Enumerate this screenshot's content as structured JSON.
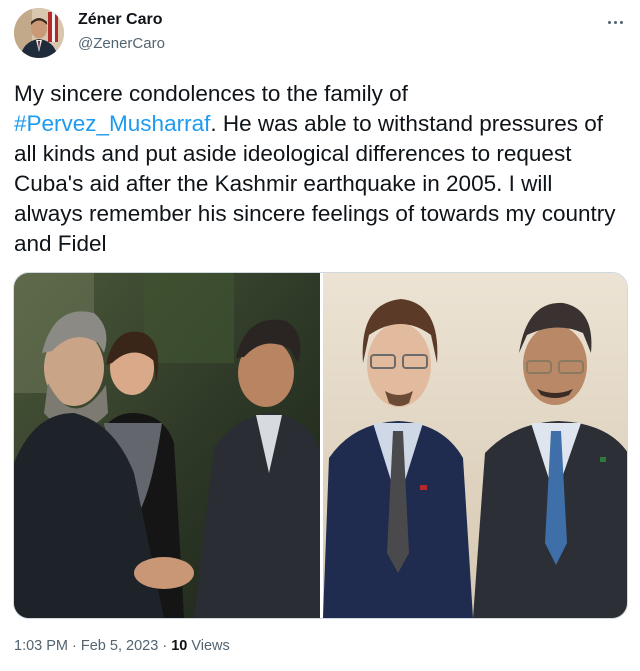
{
  "author": {
    "name": "Zéner Caro",
    "handle": "@ZenerCaro"
  },
  "tweet": {
    "text_before": "My sincere condolences to the family of\n",
    "hashtag": "#Pervez_Musharraf",
    "text_after": ". He was able to withstand pressures of all kinds and put aside ideological differences to request Cuba's aid after the Kashmir earthquake in 2005. I will always remember his sincere feelings of towards my country and Fidel"
  },
  "meta": {
    "time": "1:03 PM",
    "separator": " · ",
    "date": "Feb 5, 2023",
    "views_count": "10",
    "views_label": " Views"
  },
  "icons": {
    "more": "more-horizontal-icon"
  },
  "colors": {
    "link": "#1d9bf0",
    "secondary_text": "#536471",
    "primary_text": "#0f1419",
    "border": "#cfd9de"
  }
}
